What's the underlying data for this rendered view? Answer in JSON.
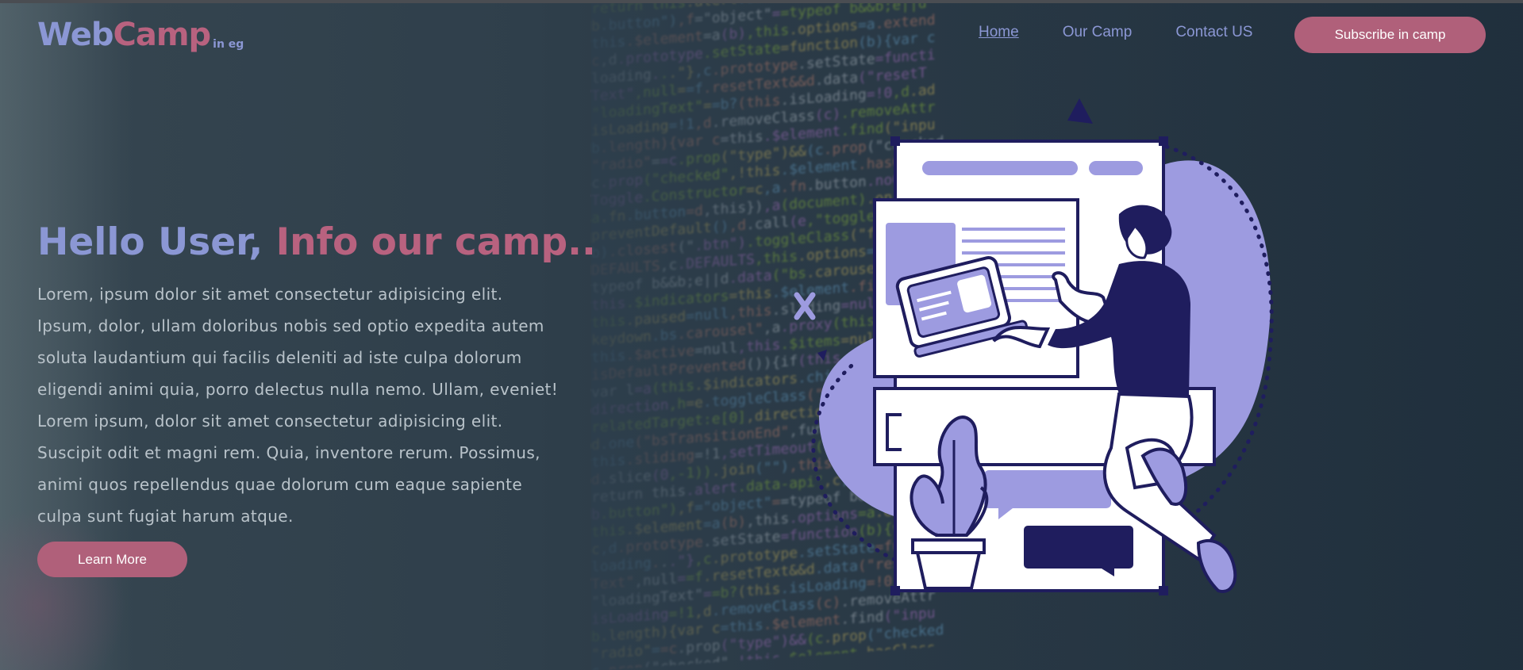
{
  "logo": {
    "web": "Web",
    "camp": "Camp",
    "sub": "in eg"
  },
  "nav": {
    "items": [
      {
        "label": "Home",
        "active": true
      },
      {
        "label": "Our Camp",
        "active": false
      },
      {
        "label": "Contact US",
        "active": false
      }
    ],
    "subscribe_label": "Subscribe in camp"
  },
  "hero": {
    "title_part1": "Hello User, ",
    "title_part2": "Info our camp..",
    "paragraph": "Lorem, ipsum dolor sit amet consectetur adipisicing elit. Ipsum, dolor, ullam doloribus nobis sed optio expedita autem soluta laudantium qui facilis deleniti ad iste culpa dolorum eligendi animi quia, porro delectus nulla nemo. Ullam, eveniet! Lorem ipsum, dolor sit amet consectetur adipisicing elit. Suscipit odit et magni rem. Quia, inventore rerum. Possimus, animi quos repellendus quae dolorum cum eaque sapiente culpa sunt fugiat harum atque.",
    "button_label": "Learn More"
  },
  "colors": {
    "accent_blue": "#8b97d4",
    "accent_pink": "#b0607a",
    "illustration_lavender": "#9d9be0",
    "illustration_navy": "#1f1d5e"
  },
  "background": {
    "code_lines": [
      "return this.alert.data-api\",c,d.prototy",
      "b.button\"),f=\"object\"==typeof b&&b;e||d",
      "this.$element=a(b),this.options=a.extend",
      "c,d.prototype.setState=function(b){var c",
      "loading...\"},c.prototype.setState=functi",
      "Text\",null==f.resetText&&d.data(\"resetT",
      "\"loadingText\"==b?(this.isLoading=!0,d.ad",
      "isLoading=!1,d.removeClass(c).removeAttr",
      "b.length){var c=this.$element.find(\"inpu",
      "\"radio\"==c.prop(\"type\")&&(c.prop(\"checked",
      "c.prop(\"checked\",!this.$element.hasClass",
      "Toggle.Constructor=c,a.fn.button.noConfl",
      "a.fn.button=d,this}),a(document).on(\"cli",
      "preventDefault(),d.call(e,\"toggle\"),a(b.t",
      "b).closest(\".btn\").toggleClass(\"focus\",/",
      "DEFAULTS,c.DEFAULTS,this.options=a.exten",
      "typeof b&&b;e||d.data(\"bs.carousel\",e=ne",
      "this.$indicators=this.$element.find(\".ca",
      "this.paused=null,this.sliding=null,this.",
      "keydown.bs.carousel\",a.proxy(this.keydow",
      "this.$active=null,this.$items=null,this.",
      "isDefaultPrevented()){if(this.sliding=!0",
      "var l=a(this.$indicators.children()[this",
      "direction,h=e.toggleClass(\"active\"),this",
      "relatedTarget:e[0],direction:g});this.$e",
      "d.one(\"bsTransitionEnd\",function(){e.rem",
      "this.sliding=!1,setTimeout(function(){i.",
      "d.slice(0,-1)).join(\"\"),this.pause(),thi"
    ]
  }
}
